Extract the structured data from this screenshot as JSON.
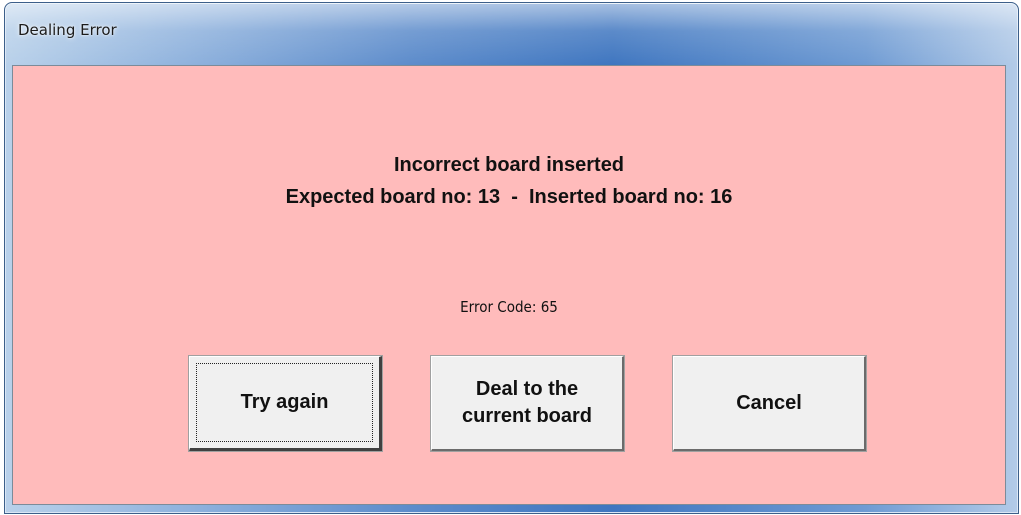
{
  "window": {
    "title": "Dealing Error"
  },
  "message": {
    "line1": "Incorrect board inserted",
    "line2": "Expected board no: 13  -  Inserted board no: 16",
    "error_code": "Error Code: 65"
  },
  "buttons": {
    "try_again": "Try again",
    "deal_current": "Deal to the current board",
    "cancel": "Cancel"
  },
  "colors": {
    "client_background": "#ffbbbb",
    "button_face": "#f0f0f0"
  }
}
